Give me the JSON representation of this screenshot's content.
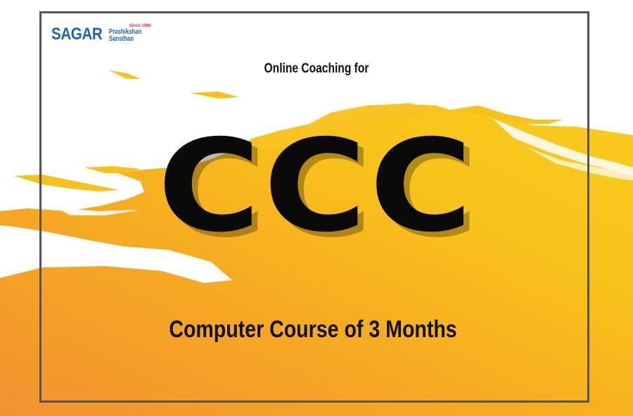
{
  "logo": {
    "main": "SAGAR",
    "since": "Since 1989",
    "line1": "Prashikshan",
    "line2": "Sansthan"
  },
  "headline": {
    "intro": "Online Coaching for",
    "title": "CCC",
    "subtitle": "Computer Course of 3 Months"
  },
  "colors": {
    "paint_yellow": "#f7c21a",
    "paint_orange": "#f39a2b",
    "frame": "#555555",
    "logo_blue": "#1f63b3",
    "logo_red": "#e0362c",
    "text": "#111111"
  }
}
